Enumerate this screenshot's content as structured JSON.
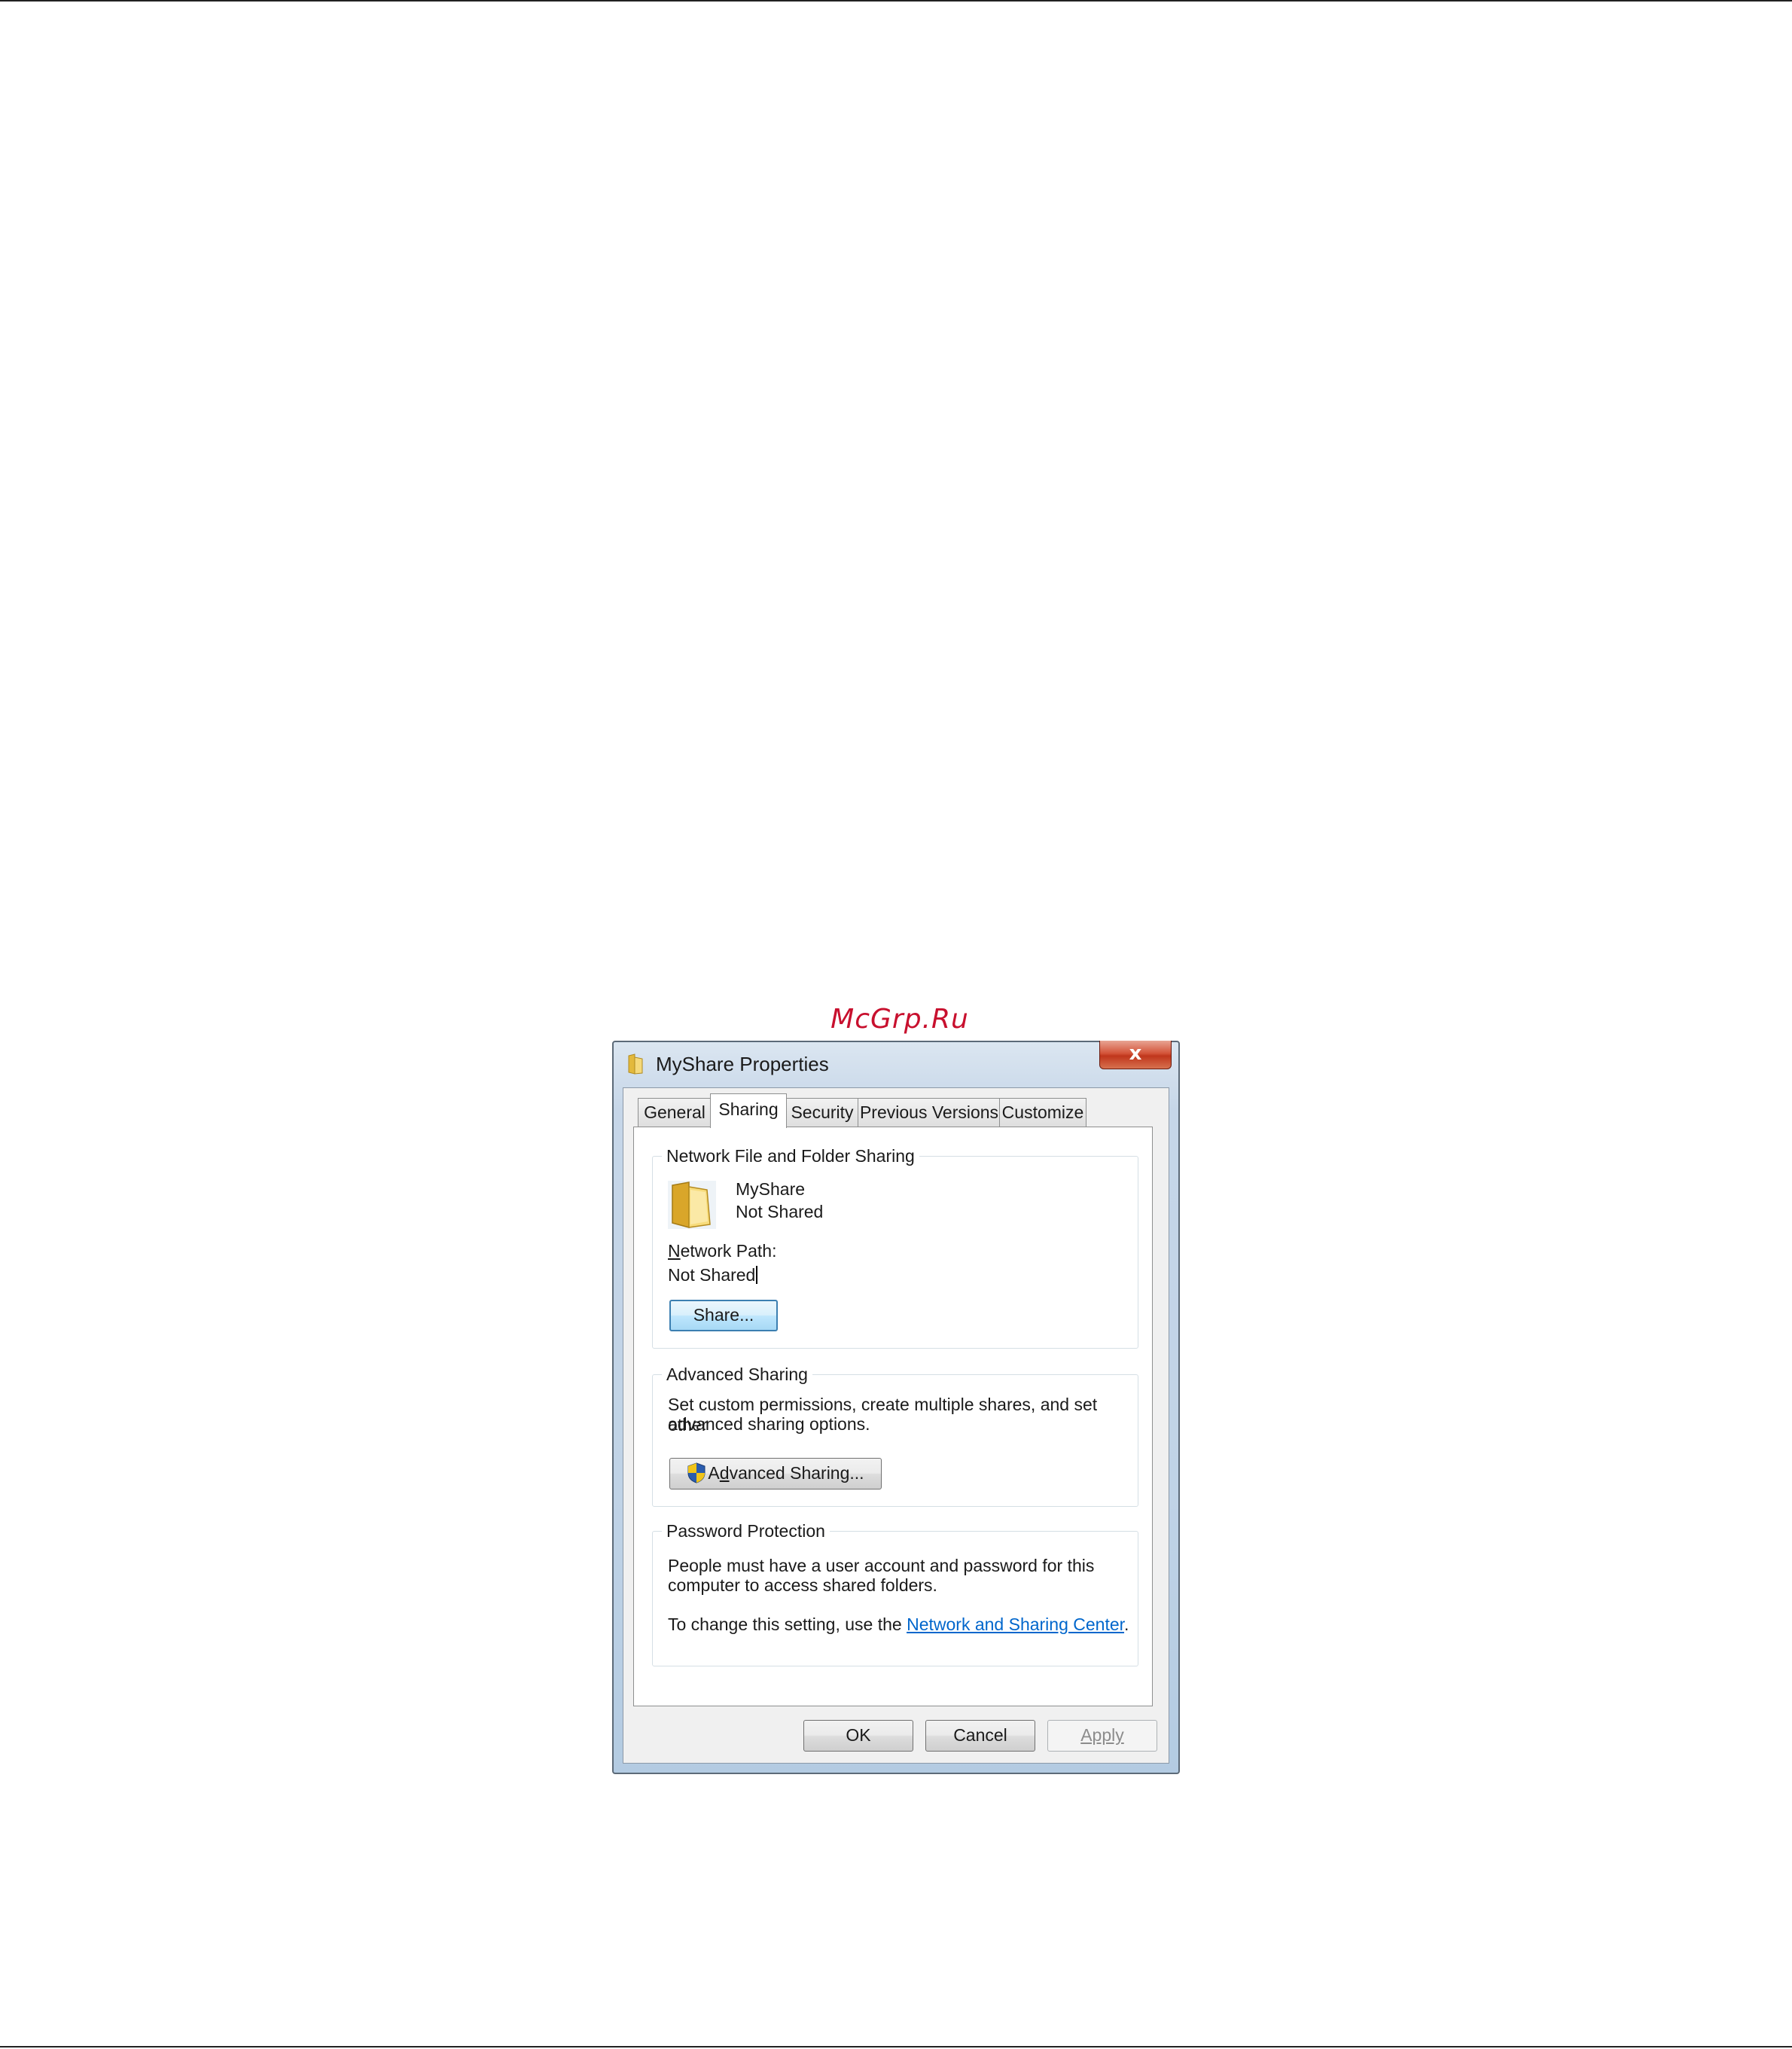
{
  "watermark": "McGrp.Ru",
  "window": {
    "title": "MyShare Properties",
    "close_label": "x"
  },
  "tabs": [
    {
      "label": "General"
    },
    {
      "label": "Sharing"
    },
    {
      "label": "Security"
    },
    {
      "label": "Previous Versions"
    },
    {
      "label": "Customize"
    }
  ],
  "selected_tab": "Sharing",
  "network_sharing": {
    "legend": "Network File and Folder Sharing",
    "folder_name": "MyShare",
    "folder_status": "Not Shared",
    "path_label": "Network Path:",
    "path_label_access_key": "N",
    "path_label_rest": "etwork Path:",
    "path_value": "Not Shared",
    "share_button": "Share..."
  },
  "advanced_sharing": {
    "legend": "Advanced Sharing",
    "description_line1": "Set custom permissions, create multiple shares, and set other",
    "description_line2": "advanced sharing options.",
    "button_pre": "A",
    "button_key": "d",
    "button_post": "vanced Sharing..."
  },
  "password_protection": {
    "legend": "Password Protection",
    "line1": "People must have a user account and password for this",
    "line2": "computer to access shared folders.",
    "change_prefix": "To change this setting, use the ",
    "link_text": "Network and Sharing Center",
    "change_suffix": "."
  },
  "footer": {
    "ok": "OK",
    "cancel": "Cancel",
    "apply": "Apply"
  }
}
